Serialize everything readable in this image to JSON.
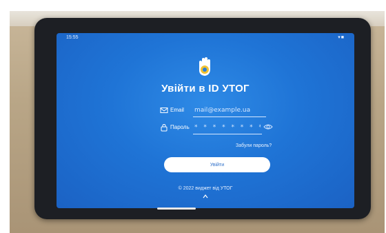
{
  "status_bar": {
    "time": "15:55",
    "icons": "▾■"
  },
  "app": {
    "title": "Увійти в ID УТОГ"
  },
  "form": {
    "email_label": "Email",
    "email_value": "mail@example.ua",
    "password_label": "Пароль",
    "password_mask": "* * * * * * * * *",
    "forgot_link": "Забули пароль?",
    "login_button": "Увійти"
  },
  "footer": {
    "text": "© 2022 виджет від УТОГ"
  },
  "colors": {
    "screen_blue": "#1f74d6",
    "accent_white": "#ffffff",
    "logo_yellow": "#f2c230"
  },
  "icons": [
    "hand-logo-icon",
    "mail-icon",
    "lock-icon",
    "eye-icon",
    "chevron-up-icon"
  ]
}
